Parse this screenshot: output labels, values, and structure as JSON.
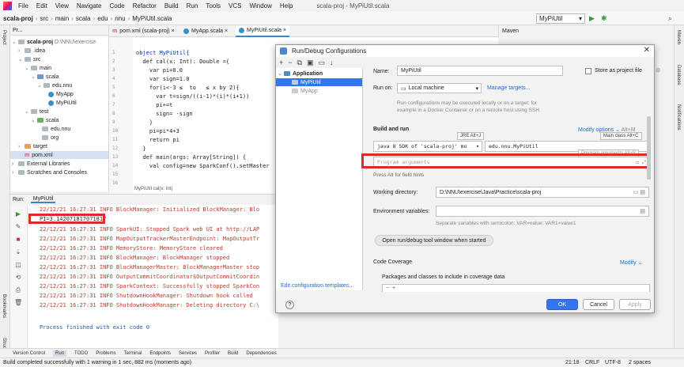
{
  "menubar": {
    "items": [
      "File",
      "Edit",
      "View",
      "Navigate",
      "Code",
      "Refactor",
      "Build",
      "Run",
      "Tools",
      "VCS",
      "Window",
      "Help"
    ],
    "project_title": "scala-proj - MyPiUtil.scala"
  },
  "navbar": {
    "crumbs": [
      "scala-proj",
      "src",
      "main",
      "scala",
      "edu",
      "nnu",
      "MyPiUtil.scala"
    ]
  },
  "runconfig": "MyPiUtil",
  "project": {
    "header": "Pr...",
    "tree": [
      {
        "label": "scala-proj",
        "extra": "D:\\NNU\\exercise"
      },
      {
        "label": ".idea"
      },
      {
        "label": "src"
      },
      {
        "label": "main"
      },
      {
        "label": "scala"
      },
      {
        "label": "edu.nnu"
      },
      {
        "label": "MyApp"
      },
      {
        "label": "MyPiUtil"
      },
      {
        "label": "test"
      },
      {
        "label": "scala"
      },
      {
        "label": "edu.nnu"
      },
      {
        "label": "org"
      },
      {
        "label": "target"
      },
      {
        "label": "pom.xml"
      },
      {
        "label": "External Libraries"
      },
      {
        "label": "Scratches and Consoles"
      }
    ]
  },
  "tabs": [
    "pom.xml (scala-proj)",
    "MyApp.scala",
    "MyPiUtil.scala"
  ],
  "maven_title": "Maven",
  "editor": {
    "line_numbers": [
      "1",
      "2",
      "3",
      "4",
      "5",
      "6",
      "7",
      "8",
      "9",
      "10",
      "11",
      "12",
      "13",
      "14",
      "15",
      "16",
      "17",
      "18"
    ],
    "lines": [
      "object MyPiUtil{",
      "  def cal(x: Int): Double ={",
      "    var pi=0.0",
      "    var sign=1.0",
      "    for(i<-3 ≤  to   ≤ x by 2){",
      "      var t=sign/((i-1)*(i)*(i+1))",
      "      pi+=t",
      "      sign= -sign",
      "    }",
      "    pi=pi*4+3",
      "    return pi",
      "  }",
      "  def main(args: Array[String]) {",
      "    val config=new SparkConf().setMaster"
    ],
    "breadcrumb": "MyPiUtil    cal(x: Int)"
  },
  "run": {
    "label": "Run:",
    "tab": "MyPiUtil",
    "logs": [
      "22/12/21 16:27:31 INFO BlockManager: Initialized BlockManager: Blo",
      "PI=3.142071817071817",
      "22/12/21 16:27:31 INFO SparkUI: Stopped Spark web UI at http://LAP",
      "22/12/21 16:27:31 INFO MapOutputTrackerMasterEndpoint: MapOutputTr",
      "22/12/21 16:27:31 INFO MemoryStore: MemoryStore cleared",
      "22/12/21 16:27:31 INFO BlockManager: BlockManager stopped",
      "22/12/21 16:27:31 INFO BlockManagerMaster: BlockManagerMaster stop",
      "22/12/21 16:27:31 INFO OutputCommitCoordinator$OutputCommitCoordin",
      "22/12/21 16:27:31 INFO SparkContext: Successfully stopped SparkCon",
      "22/12/21 16:27:31 INFO ShutdownHookManager: Shutdown hook called",
      "22/12/21 16:27:31 INFO ShutdownHookManager: Deleting directory C:\\"
    ],
    "finished": "Process finished with exit code 0"
  },
  "bottom_tabs": [
    "Version Control",
    "Run",
    "TODO",
    "Problems",
    "Terminal",
    "Endpoints",
    "Services",
    "Profiler",
    "Build",
    "Dependencies"
  ],
  "status": {
    "message": "Build completed successfully with 1 warning in 1 sec, 882 ms (moments ago)",
    "position": "21:18",
    "line_sep": "CRLF",
    "encoding": "UTF-8",
    "indent": "2 spaces"
  },
  "side_labels": {
    "project": "Project",
    "bookmarks": "Bookmarks",
    "structure": "Structure",
    "maven": "Maven",
    "database": "Database",
    "notifications": "Notifications"
  },
  "dialog": {
    "title": "Run/Debug Configurations",
    "tree_group": "Application",
    "tree_items": [
      "MyPiUtil",
      "MyApp"
    ],
    "edit_templates": "Edit configuration templates...",
    "name_label": "Name:",
    "name_value": "MyPiUtil",
    "store_label": "Store as project file",
    "runon_label": "Run on:",
    "runon_value": "Local machine",
    "manage_targets": "Manage targets...",
    "runon_hint1": "Run configurations may be executed locally or on a target: for",
    "runon_hint2": "example in a Docker Container or on a remote host using SSH.",
    "build_run": "Build and run",
    "modify_options": "Modify options",
    "modify_shortcut": "Alt+M",
    "jre_tip": "JRE Alt+J",
    "main_class_tip": "Main class Alt+C",
    "prog_args_tip": "Program arguments Alt+R",
    "java_value": "java 8  SDK of 'scala-proj' mo",
    "main_class": "edu.nnu.MyPiUtil",
    "program_args_placeholder": "Program arguments",
    "field_hints": "Press Alt for field hints",
    "workdir_label": "Working directory:",
    "workdir_value": "D:\\NNU\\exercise\\Java\\Practice\\scala-proj",
    "env_label": "Environment variables:",
    "env_hint": "Separate variables with semicolon: VAR=value; VAR1=value1",
    "open_tool": "Open run/debug tool window when started",
    "coverage": "Code Coverage",
    "modify": "Modify",
    "packages": "Packages and classes to include in coverage data",
    "ok": "OK",
    "cancel": "Cancel",
    "apply": "Apply"
  }
}
